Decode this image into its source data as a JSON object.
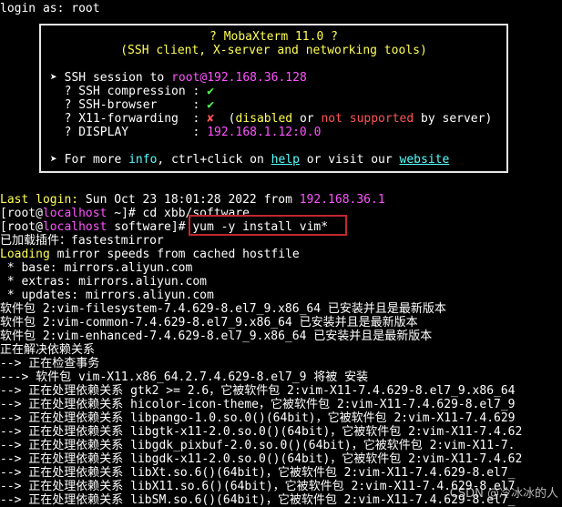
{
  "login_line": "login as: root",
  "banner": {
    "title": "? MobaXterm 11.0 ?",
    "subtitle": "(SSH client, X-server and networking tools)",
    "session_prefix": "➤ SSH session to ",
    "session_user": "root",
    "session_host": "@192.168.36.128",
    "compression_label": "  ? SSH compression : ",
    "compression_value": "✔",
    "browser_label": "  ? SSH-browser     : ",
    "browser_value": "✔",
    "x11_label": "  ? X11-forwarding  : ",
    "x11_value": "✘",
    "x11_note_open": "  (",
    "x11_disabled": "disabled",
    "x11_or": " or ",
    "x11_not_supported": "not supported",
    "x11_by_server": " by server)",
    "display_label": "  ? DISPLAY         : ",
    "display_value": "192.168.1.12:0.0",
    "more_prefix": "➤ For more ",
    "more_info": "info",
    "more_mid": ", ctrl+click on ",
    "more_help": "help",
    "more_visit": " or visit our ",
    "more_website": "website"
  },
  "last_login_label": "Last login: ",
  "last_login_value": "Sun Oct 23 18:01:28 2022 from ",
  "last_login_ip": "192.168.36.1",
  "prompt1_user": "[root@",
  "prompt1_host": "localhost",
  "prompt1_rest": " ~]# cd xbb/software",
  "prompt2_user": "[root@",
  "prompt2_host": "localhost",
  "prompt2_rest": " software]# ",
  "command": "yum -y install vim*",
  "output": [
    "已加载插件：fastestmirror",
    "Loading mirror speeds from cached hostfile",
    " * base: mirrors.aliyun.com",
    " * extras: mirrors.aliyun.com",
    " * updates: mirrors.aliyun.com",
    "软件包 2:vim-filesystem-7.4.629-8.el7_9.x86_64 已安装并且是最新版本",
    "软件包 2:vim-common-7.4.629-8.el7_9.x86_64 已安装并且是最新版本",
    "软件包 2:vim-enhanced-7.4.629-8.el7_9.x86_64 已安装并且是最新版本",
    "正在解决依赖关系",
    "--> 正在检查事务",
    "---> 软件包 vim-X11.x86_64.2.7.4.629-8.el7_9 将被 安装",
    "--> 正在处理依赖关系 gtk2 >= 2.6，它被软件包 2:vim-X11-7.4.629-8.el7_9.x86_64",
    "--> 正在处理依赖关系 hicolor-icon-theme，它被软件包 2:vim-X11-7.4.629-8.el7_9",
    "--> 正在处理依赖关系 libpango-1.0.so.0()(64bit)，它被软件包 2:vim-X11-7.4.629",
    "--> 正在处理依赖关系 libgtk-x11-2.0.so.0()(64bit)，它被软件包 2:vim-X11-7.4.62",
    "--> 正在处理依赖关系 libgdk_pixbuf-2.0.so.0()(64bit)，它被软件包 2:vim-X11-7.",
    "--> 正在处理依赖关系 libgdk-x11-2.0.so.0()(64bit)，它被软件包 2:vim-X11-7.4.62",
    "--> 正在处理依赖关系 libXt.so.6()(64bit)，它被软件包 2:vim-X11-7.4.629-8.el7_",
    "--> 正在处理依赖关系 libX11.so.6()(64bit)，它被软件包 2:vim-X11-7.4.629-8.el7",
    "--> 正在处理依赖关系 libSM.so.6()(64bit)，它被软件包 2:vim-X11-7.4.629-8.el7_"
  ],
  "watermark": "CSDN @冷冰冰的人"
}
